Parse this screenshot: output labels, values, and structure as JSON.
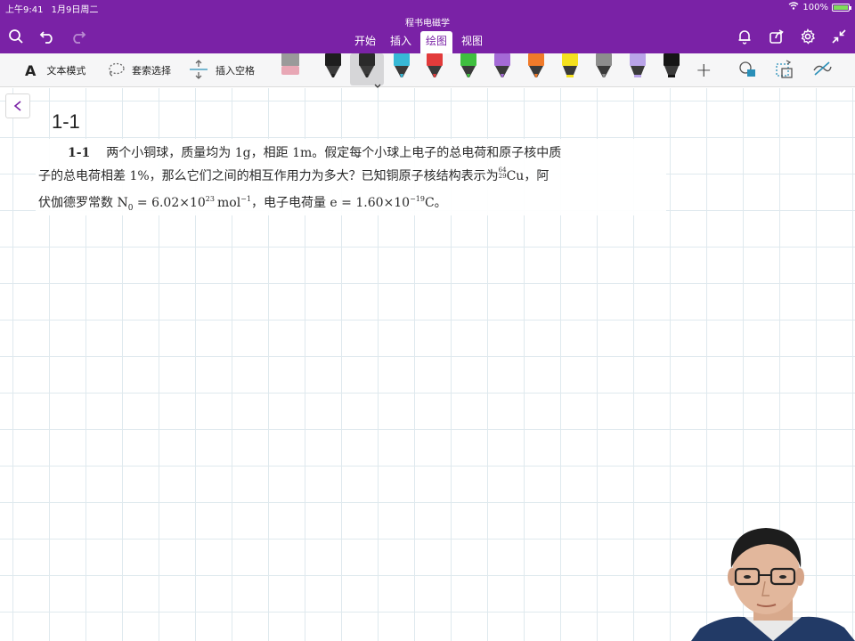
{
  "status_bar": {
    "time": "上午9:41",
    "date": "1月9日周二",
    "battery": "100%"
  },
  "app": {
    "title": "程书电磁学"
  },
  "toolbar": {
    "icons": [
      "search-icon",
      "undo-icon",
      "redo-icon",
      "bell-icon",
      "share-icon",
      "gear-icon",
      "collapse-icon"
    ]
  },
  "tabs": [
    {
      "label": "开始",
      "active": false
    },
    {
      "label": "插入",
      "active": false
    },
    {
      "label": "绘图",
      "active": true
    },
    {
      "label": "视图",
      "active": false
    }
  ],
  "ribbon": {
    "text_mode_label": "文本模式",
    "lasso_label": "套索选择",
    "insert_space_label": "插入空格",
    "text_mode_glyph": "A",
    "pens": [
      {
        "name": "eraser",
        "color": "#e8a7b5"
      },
      {
        "name": "black-pen",
        "color": "#1e1e1e"
      },
      {
        "name": "black-pen-selected",
        "color": "#2a2a2a"
      },
      {
        "name": "cyan-pen",
        "color": "#37b8d6"
      },
      {
        "name": "red-pen",
        "color": "#e23b3b"
      },
      {
        "name": "green-pen",
        "color": "#3fbf3f"
      },
      {
        "name": "purple-pen",
        "color": "#a46ad6"
      },
      {
        "name": "orange-pen",
        "color": "#f07a2a"
      },
      {
        "name": "yellow-highlighter",
        "color": "#f5e11e"
      },
      {
        "name": "gray-pen",
        "color": "#8d8d8d"
      },
      {
        "name": "lavender-highlighter",
        "color": "#b9a3e8"
      },
      {
        "name": "black-marker",
        "color": "#151515"
      }
    ],
    "add_glyph": "+"
  },
  "page": {
    "title": "1-1",
    "problem": {
      "number": "1-1",
      "line1": "两个小铜球，质量均为 1g，相距 1m。假定每个小球上电子的总电荷和原子核中质",
      "line2": "子的总电荷相差 1%，那么它们之间的相互作用力为多大？已知铜原子核结构表示为",
      "isotope_mass": "64",
      "isotope_z": "29",
      "line2_tail": "Cu，阿",
      "line3_a": "伏伽德罗常数 N",
      "line3_sub": "0",
      "line3_b": " = 6.02×10",
      "line3_exp1": "23",
      "line3_c": "mol",
      "line3_exp2": "−1",
      "line3_d": "，电子电荷量 e = 1.60×10",
      "line3_exp3": "−19",
      "line3_e": "C。"
    }
  },
  "colors": {
    "brand": "#7a22a6",
    "grid": "#dfe9ee"
  }
}
